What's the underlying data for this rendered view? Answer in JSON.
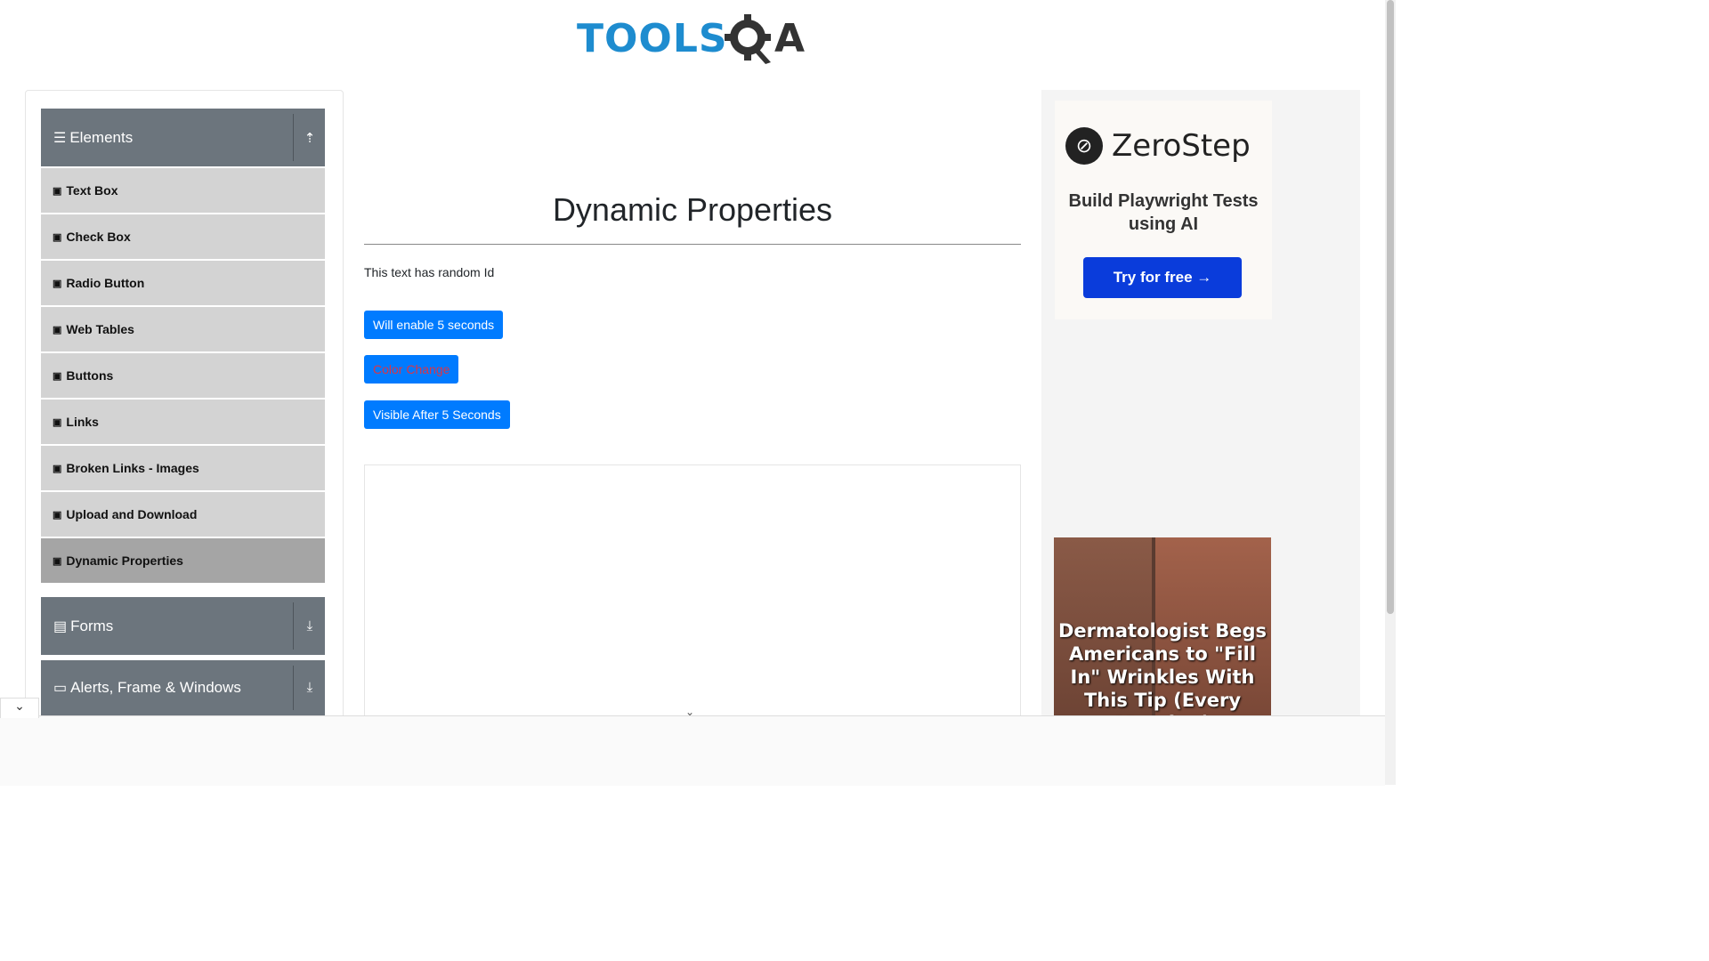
{
  "header": {
    "logo_tools": "TOOLS",
    "logo_q_icon": "gear-q-icon",
    "logo_a": "A"
  },
  "sidebar": {
    "groups": [
      {
        "label": "Elements",
        "icon": "hamburger-icon",
        "toggle_icon": "collapse-up-icon",
        "expanded": true
      },
      {
        "label": "Forms",
        "icon": "document-icon",
        "toggle_icon": "expand-down-icon",
        "expanded": false
      },
      {
        "label": "Alerts, Frame & Windows",
        "icon": "window-icon",
        "toggle_icon": "expand-down-icon",
        "expanded": false
      }
    ],
    "items": [
      {
        "label": "Text Box"
      },
      {
        "label": "Check Box"
      },
      {
        "label": "Radio Button"
      },
      {
        "label": "Web Tables"
      },
      {
        "label": "Buttons"
      },
      {
        "label": "Links"
      },
      {
        "label": "Broken Links - Images"
      },
      {
        "label": "Upload and Download"
      },
      {
        "label": "Dynamic Properties",
        "active": true
      }
    ]
  },
  "main": {
    "title": "Dynamic Properties",
    "random_id_text": "This text has random Id",
    "buttons": {
      "enable_after": "Will enable 5 seconds",
      "color_change": "Color Change",
      "visible_after": "Visible After 5 Seconds"
    }
  },
  "ads": {
    "zerostep": {
      "brand": "ZeroStep",
      "tagline": "Build Playwright Tests using AI",
      "cta": "Try for free →"
    },
    "promo_headline": "Dermatologist Begs Americans to \"Fill In\" Wrinkles With This Tip (Every Morning)"
  },
  "colors": {
    "primary_button": "#007bff",
    "sidebar_header": "#6c757d",
    "menu_item": "#d3d3d3",
    "menu_item_active": "#a5a5a5",
    "logo_blue": "#1e8ccf",
    "color_change_text": "#dc3545"
  }
}
